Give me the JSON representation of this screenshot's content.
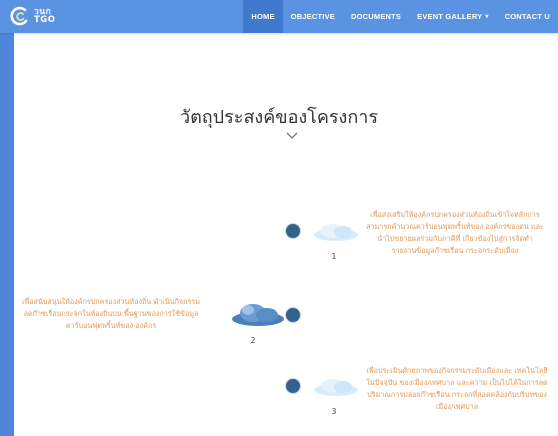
{
  "navbar": {
    "logo_line1": "วนก",
    "logo_line2": "TGO",
    "items": [
      {
        "label": "HOME",
        "active": true
      },
      {
        "label": "OBJECTIVE"
      },
      {
        "label": "DOCUMENTS"
      },
      {
        "label": "EVENT GALLERY"
      },
      {
        "label": "CONTACT U"
      }
    ]
  },
  "section": {
    "title": "วัตถุประสงค์ของโครงการ"
  },
  "objectives": [
    {
      "number": "1",
      "text": "เพื่อส่งเสริมให้องค์กรปกครองส่วนท้องถิ่นเข้าใจหลักการ สามารถคำนวณคาร์บอนฟุตพริ้นท์ของ องค์กรของตน และนำไปขยายผลร่วมกับภาคีที่ เกี่ยวข้องไปสู่การจัดทำรายงานข้อมูลก๊าซเรือน กระจกระดับเมือง"
    },
    {
      "number": "2",
      "text": "เพื่อสนับสนุนให้องค์กรปกครองส่วนท้องถิ่น ดำเนินกิจกรรมลดก๊าซเรือนกระจกในท้องถิ่นบน พื้นฐานของการใช้ข้อมูลคาร์บอนฟุตพริ้นท์ของ องค์กร"
    },
    {
      "number": "3",
      "text": "เพื่อประเมินศักยภาพของกิจกรรมระดับเมืองและ เทคโนโลยีในปัจจุบัน ของเมือง/เทศบาล และความ เป็นไปได้ในการลดปริมาณการปล่อยก๊าซเรือน กระจกที่สอดคล้องกับบริบทของเมือง/เทศบาล"
    }
  ],
  "colors": {
    "navbar": "#5b93e3",
    "nav_active": "#3f78cc",
    "timeline_dot": "#34628d",
    "description_text": "#e29a5a"
  }
}
